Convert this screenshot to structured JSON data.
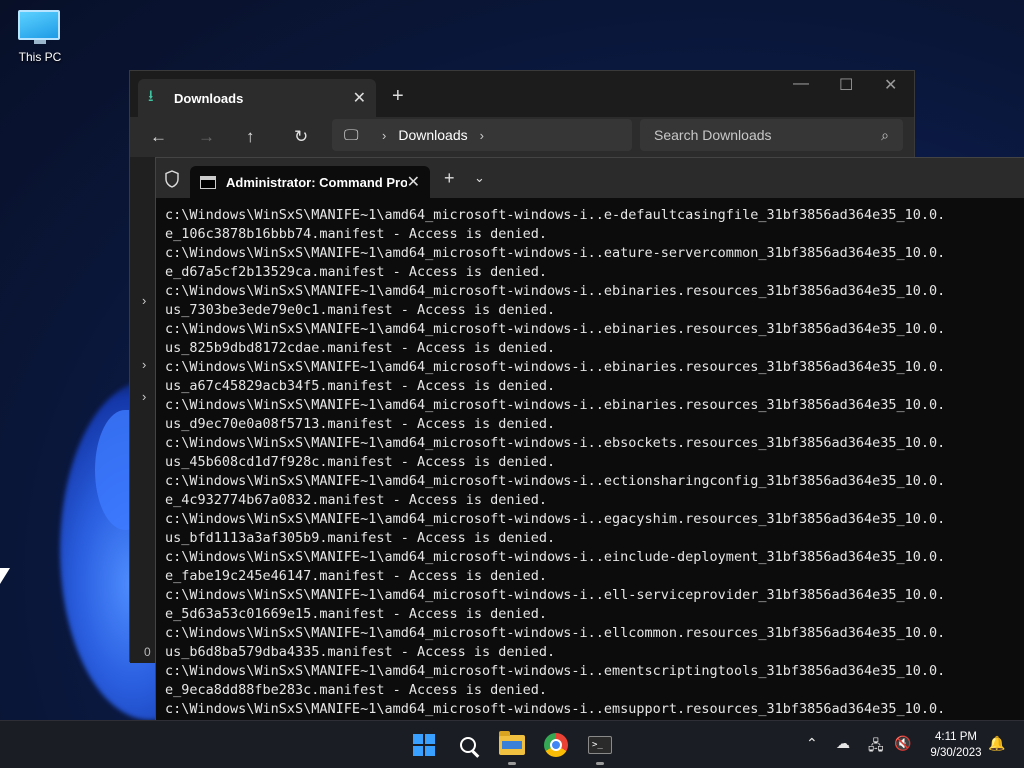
{
  "desktop": {
    "icons": [
      {
        "label": "This PC",
        "icon": "monitor-icon"
      }
    ]
  },
  "explorer": {
    "tab_title": "Downloads",
    "address_segments": [
      "Downloads"
    ],
    "search_placeholder": "Search Downloads",
    "status_count": "0"
  },
  "terminal": {
    "tab_title": "Administrator: Command Pro",
    "output_lines": [
      "c:\\Windows\\WinSxS\\MANIFE~1\\amd64_microsoft-windows-i..e-defaultcasingfile_31bf3856ad364e35_10.0.",
      "e_106c3878b16bbb74.manifest - Access is denied.",
      "c:\\Windows\\WinSxS\\MANIFE~1\\amd64_microsoft-windows-i..eature-servercommon_31bf3856ad364e35_10.0.",
      "e_d67a5cf2b13529ca.manifest - Access is denied.",
      "c:\\Windows\\WinSxS\\MANIFE~1\\amd64_microsoft-windows-i..ebinaries.resources_31bf3856ad364e35_10.0.",
      "us_7303be3ede79e0c1.manifest - Access is denied.",
      "c:\\Windows\\WinSxS\\MANIFE~1\\amd64_microsoft-windows-i..ebinaries.resources_31bf3856ad364e35_10.0.",
      "us_825b9dbd8172cdae.manifest - Access is denied.",
      "c:\\Windows\\WinSxS\\MANIFE~1\\amd64_microsoft-windows-i..ebinaries.resources_31bf3856ad364e35_10.0.",
      "us_a67c45829acb34f5.manifest - Access is denied.",
      "c:\\Windows\\WinSxS\\MANIFE~1\\amd64_microsoft-windows-i..ebinaries.resources_31bf3856ad364e35_10.0.",
      "us_d9ec70e0a08f5713.manifest - Access is denied.",
      "c:\\Windows\\WinSxS\\MANIFE~1\\amd64_microsoft-windows-i..ebsockets.resources_31bf3856ad364e35_10.0.",
      "us_45b608cd1d7f928c.manifest - Access is denied.",
      "c:\\Windows\\WinSxS\\MANIFE~1\\amd64_microsoft-windows-i..ectionsharingconfig_31bf3856ad364e35_10.0.",
      "e_4c932774b67a0832.manifest - Access is denied.",
      "c:\\Windows\\WinSxS\\MANIFE~1\\amd64_microsoft-windows-i..egacyshim.resources_31bf3856ad364e35_10.0.",
      "us_bfd1113a3af305b9.manifest - Access is denied.",
      "c:\\Windows\\WinSxS\\MANIFE~1\\amd64_microsoft-windows-i..einclude-deployment_31bf3856ad364e35_10.0.",
      "e_fabe19c245e46147.manifest - Access is denied.",
      "c:\\Windows\\WinSxS\\MANIFE~1\\amd64_microsoft-windows-i..ell-serviceprovider_31bf3856ad364e35_10.0.",
      "e_5d63a53c01669e15.manifest - Access is denied.",
      "c:\\Windows\\WinSxS\\MANIFE~1\\amd64_microsoft-windows-i..ellcommon.resources_31bf3856ad364e35_10.0.",
      "us_b6d8ba579dba4335.manifest - Access is denied.",
      "c:\\Windows\\WinSxS\\MANIFE~1\\amd64_microsoft-windows-i..ementscriptingtools_31bf3856ad364e35_10.0.",
      "e_9eca8dd88fbe283c.manifest - Access is denied.",
      "c:\\Windows\\WinSxS\\MANIFE~1\\amd64_microsoft-windows-i..emsupport.resources_31bf3856ad364e35_10.0."
    ]
  },
  "taskbar": {
    "apps": [
      {
        "name": "start",
        "icon": "windows-logo-icon"
      },
      {
        "name": "search",
        "icon": "search-icon"
      },
      {
        "name": "file-explorer",
        "icon": "folder-icon",
        "running": true
      },
      {
        "name": "chrome",
        "icon": "chrome-icon"
      },
      {
        "name": "terminal",
        "icon": "terminal-icon",
        "running": true
      }
    ],
    "tray_icons": [
      "chevron-up-icon",
      "onedrive-icon",
      "network-icon",
      "volume-muted-icon",
      "notification-bell-icon"
    ],
    "time": "4:11 PM",
    "date": "9/30/2023"
  },
  "colors": {
    "accent": "#3aa0ff",
    "terminal_bg": "#0c0c0c",
    "explorer_bg": "#202020",
    "taskbar_bg": "#1b1d24"
  }
}
